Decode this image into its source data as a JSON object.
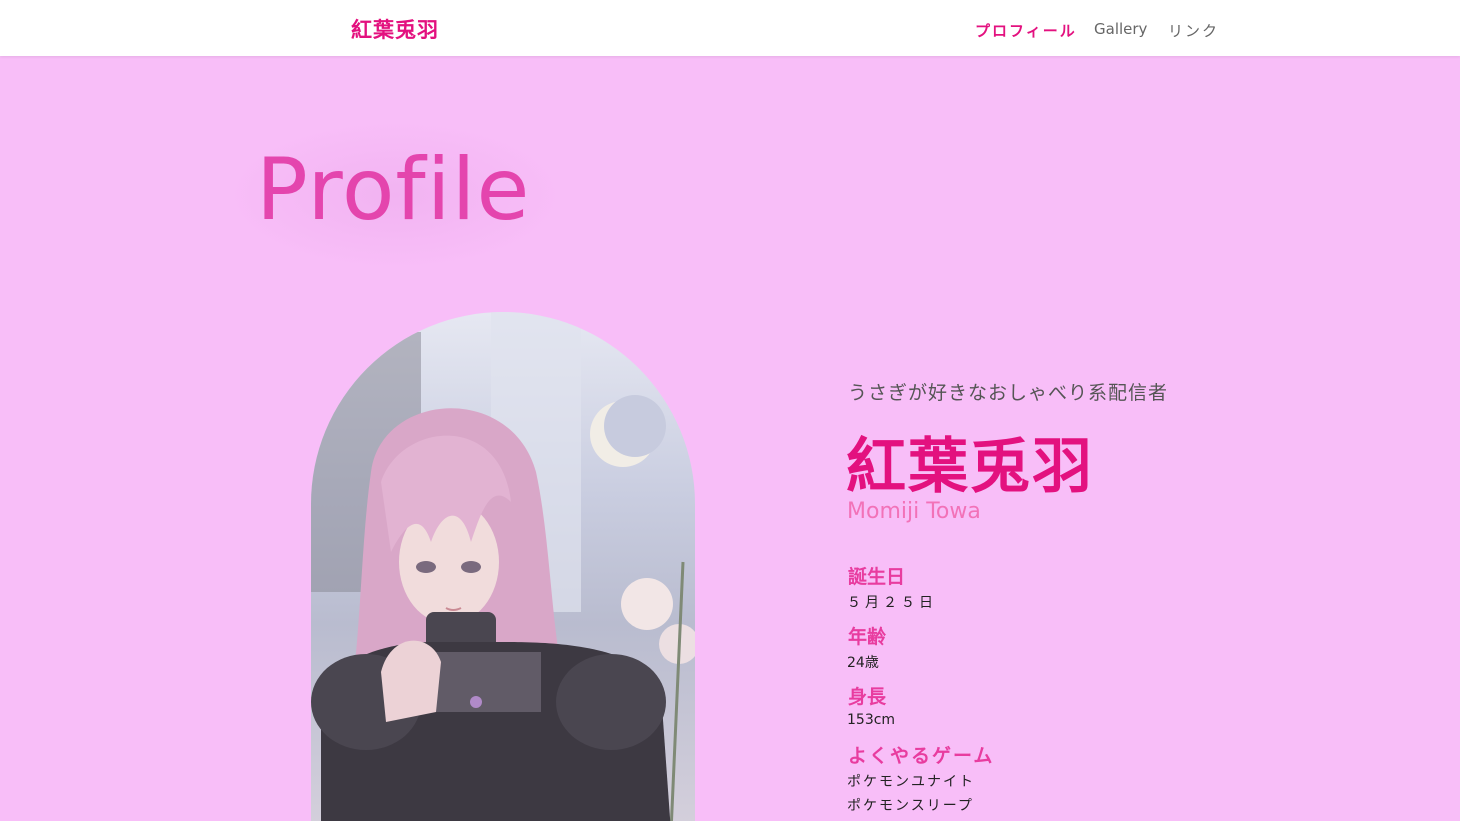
{
  "nav": {
    "brand": "紅葉兎羽",
    "items": [
      {
        "label": "プロフィール",
        "active": true
      },
      {
        "label": "Gallery",
        "active": false
      },
      {
        "label": "リンク",
        "active": false
      }
    ]
  },
  "page_title": "Profile",
  "profile": {
    "catchphrase": "うさぎが好きなおしゃべり系配信者",
    "name_jp": "紅葉兎羽",
    "name_en": "Momiji Towa",
    "fields": [
      {
        "label": "誕生日",
        "values": [
          "５月２５日"
        ]
      },
      {
        "label": "年齢",
        "values": [
          "24歳"
        ]
      },
      {
        "label": "身長",
        "values": [
          "153cm"
        ]
      },
      {
        "label": "よくやるゲーム",
        "values": [
          "ポケモンユナイト",
          "ポケモンスリープ"
        ]
      }
    ]
  },
  "colors": {
    "background": "#f8bef8",
    "accent": "#e3117f",
    "label": "#e83c9f",
    "name_en": "#f272b8"
  }
}
